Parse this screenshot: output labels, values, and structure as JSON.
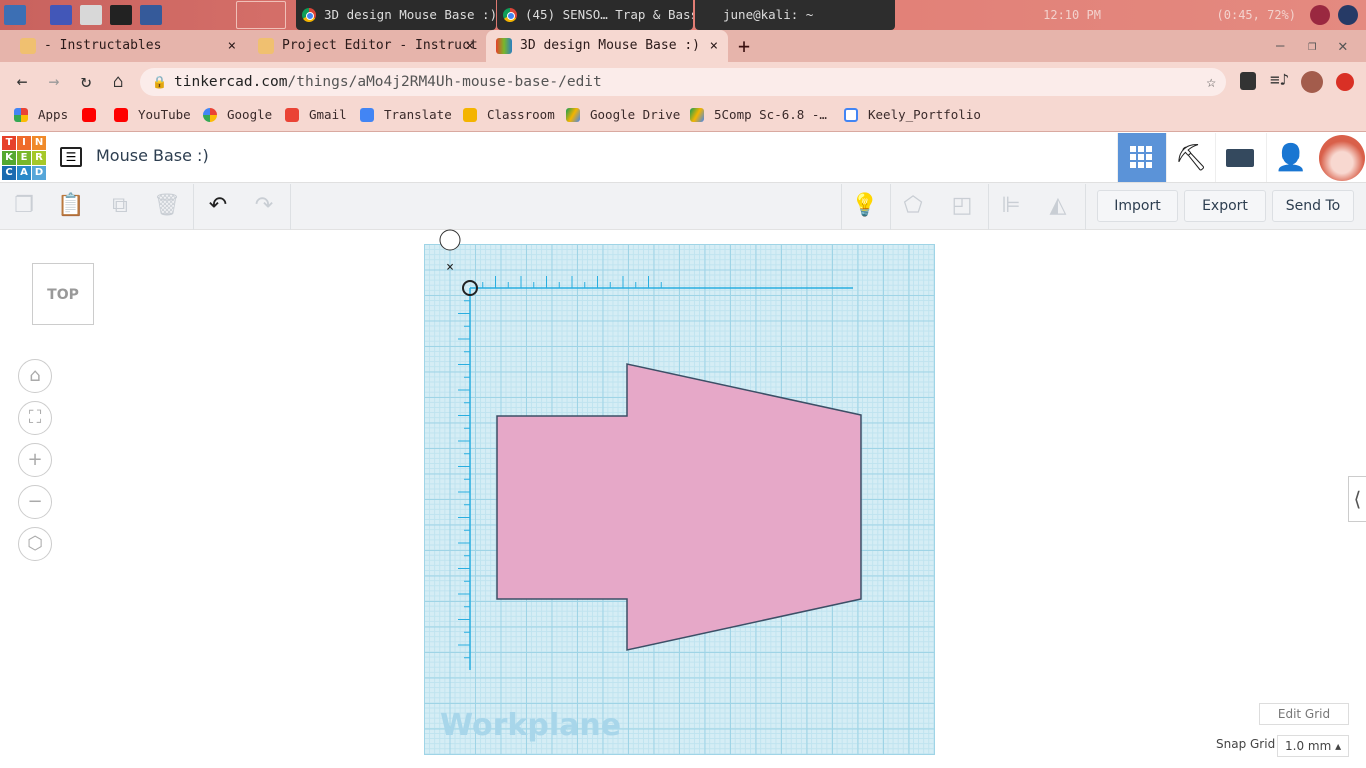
{
  "taskbar": {
    "tasks": [
      {
        "label": "3D design Mouse Base :)…"
      },
      {
        "label": "(45) SENSO… Trap & Bass…"
      },
      {
        "label": "june@kali: ~"
      }
    ],
    "clock": "12:10 PM",
    "battery": "(0:45, 72%)"
  },
  "browser": {
    "tabs": [
      {
        "label": "- Instructables",
        "close": "×"
      },
      {
        "label": "Project Editor - Instruct",
        "close": "×"
      },
      {
        "label": "3D design Mouse Base :)",
        "close": "×"
      }
    ],
    "new_tab": "+",
    "url_host": "tinkercad.com",
    "url_path": "/things/aMo4j2RM4Uh-mouse-base-/edit",
    "bookmarks": [
      {
        "label": "Apps",
        "color": "#4285f4"
      },
      {
        "label": "",
        "color": "#ff0000"
      },
      {
        "label": "YouTube",
        "color": "#ff0000"
      },
      {
        "label": "Google",
        "color": "#4285f4"
      },
      {
        "label": "Gmail",
        "color": "#ea4335"
      },
      {
        "label": "Translate",
        "color": "#4285f4"
      },
      {
        "label": "Classroom",
        "color": "#f4b400"
      },
      {
        "label": "Google Drive",
        "color": "#0f9d58"
      },
      {
        "label": "5Comp Sc-6.8 -…",
        "color": "#0f9d58"
      },
      {
        "label": "Keely_Portfolio",
        "color": "#4285f4"
      }
    ]
  },
  "app": {
    "logo_letters": [
      "T",
      "I",
      "N",
      "K",
      "E",
      "R",
      "C",
      "A",
      "D"
    ],
    "design_title": "Mouse Base :)",
    "toolbar": {
      "import": "Import",
      "export": "Export",
      "send_to": "Send To"
    },
    "view_cube": "TOP",
    "workplane_label": "Workplane",
    "edit_grid": "Edit Grid",
    "snap_grid_label": "Snap Grid",
    "snap_grid_value": "1.0 mm ▴",
    "accent": "#5b93d8",
    "shape_color": "#e6a8c8"
  }
}
